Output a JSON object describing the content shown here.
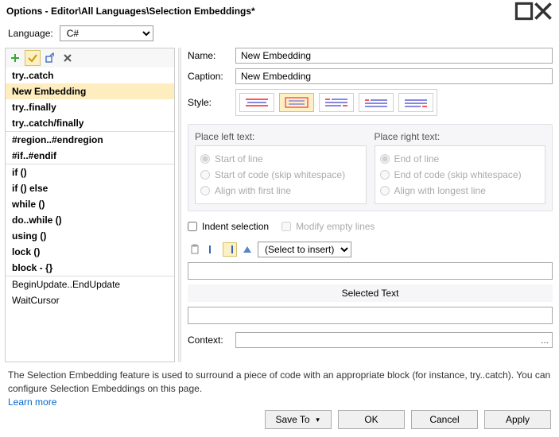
{
  "titlebar": {
    "title": "Options - Editor\\All Languages\\Selection Embeddings*"
  },
  "language": {
    "label": "Language:",
    "value": "C#"
  },
  "list": {
    "groups": [
      {
        "items": [
          {
            "label": "try..catch",
            "bold": true
          },
          {
            "label": "New Embedding",
            "bold": true,
            "selected": true
          },
          {
            "label": "try..finally",
            "bold": true
          },
          {
            "label": "try..catch/finally",
            "bold": true
          }
        ]
      },
      {
        "items": [
          {
            "label": "#region..#endregion",
            "bold": true
          },
          {
            "label": "#if..#endif",
            "bold": true
          }
        ]
      },
      {
        "items": [
          {
            "label": "if ()",
            "bold": true
          },
          {
            "label": "if () else",
            "bold": true
          },
          {
            "label": "while ()",
            "bold": true
          },
          {
            "label": "do..while ()",
            "bold": true
          },
          {
            "label": "using ()",
            "bold": true
          },
          {
            "label": "lock ()",
            "bold": true
          },
          {
            "label": "block - {}",
            "bold": true
          }
        ]
      },
      {
        "items": [
          {
            "label": "BeginUpdate..EndUpdate",
            "bold": false
          },
          {
            "label": "WaitCursor",
            "bold": false
          }
        ]
      }
    ]
  },
  "form": {
    "name_label": "Name:",
    "name_value": "New Embedding",
    "caption_label": "Caption:",
    "caption_value": "New Embedding",
    "style_label": "Style:"
  },
  "place": {
    "left_legend": "Place left text:",
    "left_options": [
      "Start of line",
      "Start of code (skip whitespace)",
      "Align with first line"
    ],
    "right_legend": "Place right text:",
    "right_options": [
      "End of line",
      "End of code (skip whitespace)",
      "Align with longest line"
    ]
  },
  "checks": {
    "indent_label": "Indent selection",
    "modify_label": "Modify empty lines"
  },
  "insert": {
    "dropdown": "(Select to insert)"
  },
  "selected_text_label": "Selected Text",
  "context": {
    "label": "Context:"
  },
  "description": {
    "text": "The Selection Embedding feature is used to surround a piece of code with an appropriate block (for instance, try..catch). You can configure Selection Embeddings on this page.",
    "link": "Learn more"
  },
  "buttons": {
    "save_to": "Save To",
    "ok": "OK",
    "cancel": "Cancel",
    "apply": "Apply"
  }
}
